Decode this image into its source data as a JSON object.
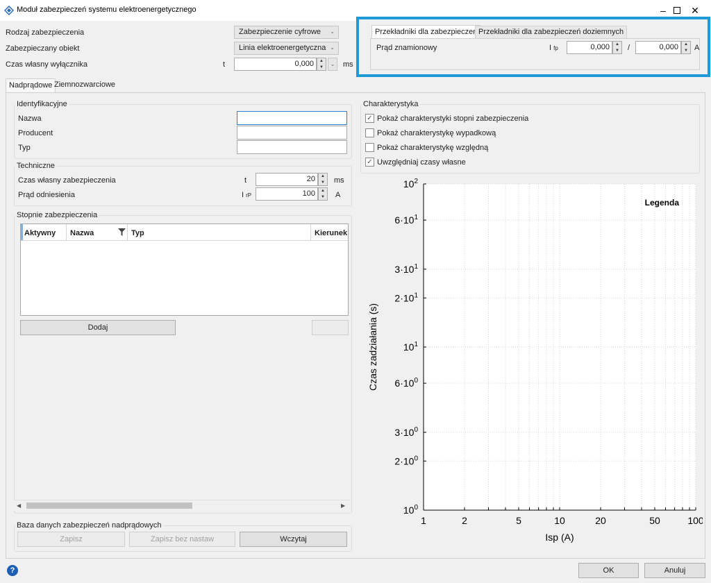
{
  "window": {
    "title": "Moduł zabezpieczeń systemu elektroenergetycznego"
  },
  "top": {
    "protection_type_label": "Rodzaj zabezpieczenia",
    "protection_type_value": "Zabezpieczenie cyfrowe",
    "protected_object_label": "Zabezpieczany obiekt",
    "protected_object_value": "Linia elektroenergetyczna",
    "breaker_time_label": "Czas własny wyłącznika",
    "breaker_time_symbol": "t",
    "breaker_time_value": "0,000",
    "breaker_time_unit": "ms"
  },
  "ct_panel": {
    "tab1": "Przekładniki dla zabezpieczeń",
    "tab2": "Przekładniki dla zabezpieczeń doziemnych",
    "rated_current_label": "Prąd znamionowy",
    "symbol_I": "I",
    "symbol_sub": "fp",
    "primary_value": "0,000",
    "separator": "/",
    "secondary_value": "0,000",
    "unit": "A"
  },
  "main_tabs": {
    "tab1": "Nadprądowe",
    "tab2": "Ziemnozwarciowe"
  },
  "identification": {
    "title": "Identyfikacyjne",
    "name_label": "Nazwa",
    "manufacturer_label": "Producent",
    "type_label": "Typ",
    "name_value": "",
    "manufacturer_value": "",
    "type_value": ""
  },
  "technical": {
    "title": "Techniczne",
    "own_time_label": "Czas własny zabezpieczenia",
    "own_time_symbol": "t",
    "own_time_value": "20",
    "own_time_unit": "ms",
    "ref_current_label": "Prąd odniesienia",
    "ref_current_symbol": "I",
    "ref_current_sub": "rP",
    "ref_current_value": "100",
    "ref_current_unit": "A"
  },
  "stages": {
    "title": "Stopnie zabezpieczenia",
    "columns": [
      "Aktywny",
      "Nazwa",
      "Typ",
      "Kierunek"
    ],
    "add_button": "Dodaj"
  },
  "database": {
    "title": "Baza danych zabezpieczeń nadprądowych",
    "save": "Zapisz",
    "save_no_settings": "Zapisz bez nastaw",
    "load": "Wczytaj"
  },
  "characteristic": {
    "title": "Charakterystyka",
    "options": [
      {
        "label": "Pokaż charakterystyki stopni zabezpieczenia",
        "checked": true
      },
      {
        "label": "Pokaż charakterystykę wypadkową",
        "checked": false
      },
      {
        "label": "Pokaż charakterystykę względną",
        "checked": false
      },
      {
        "label": "Uwzględniaj czasy własne",
        "checked": true
      }
    ]
  },
  "chart_data": {
    "type": "line",
    "xscale": "log",
    "yscale": "log",
    "xlim": [
      1,
      100
    ],
    "ylim": [
      1,
      100
    ],
    "xlabel": "Isp (A)",
    "ylabel": "Czas zadziałania (s)",
    "legend_title": "Legenda",
    "x_ticks": [
      {
        "v": 1,
        "label": "1"
      },
      {
        "v": 2,
        "label": "2"
      },
      {
        "v": 5,
        "label": "5"
      },
      {
        "v": 10,
        "label": "10"
      },
      {
        "v": 20,
        "label": "20"
      },
      {
        "v": 50,
        "label": "50"
      },
      {
        "v": 100,
        "label": "100"
      }
    ],
    "y_ticks": [
      {
        "v": 1,
        "base": "10",
        "exp": "0"
      },
      {
        "v": 2,
        "base": "2·10",
        "exp": "0"
      },
      {
        "v": 3,
        "base": "3·10",
        "exp": "0"
      },
      {
        "v": 6,
        "base": "6·10",
        "exp": "0"
      },
      {
        "v": 10,
        "base": "10",
        "exp": "1"
      },
      {
        "v": 20,
        "base": "2·10",
        "exp": "1"
      },
      {
        "v": 30,
        "base": "3·10",
        "exp": "1"
      },
      {
        "v": 60,
        "base": "6·10",
        "exp": "1"
      },
      {
        "v": 100,
        "base": "10",
        "exp": "2"
      }
    ],
    "series": []
  },
  "footer": {
    "help": "?",
    "ok": "OK",
    "cancel": "Anuluj"
  }
}
